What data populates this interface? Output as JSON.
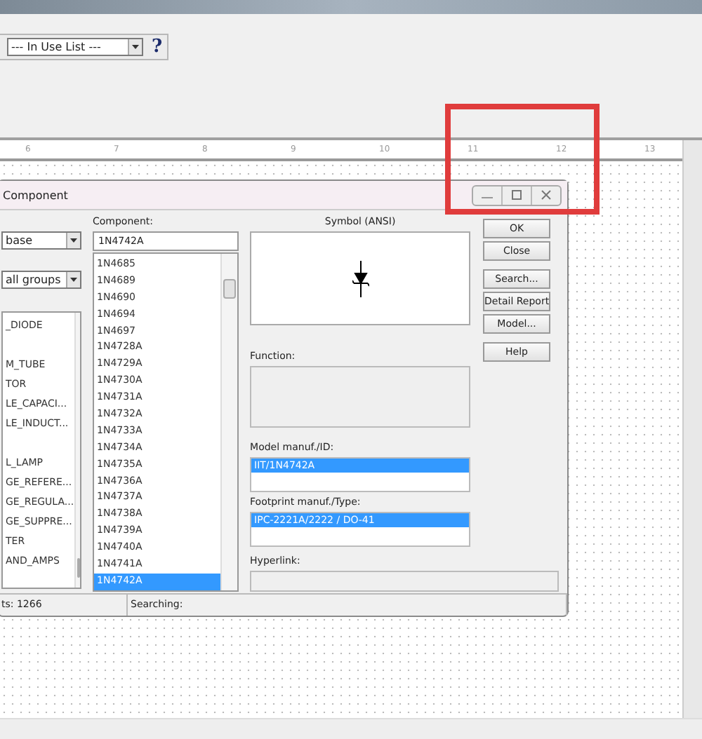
{
  "toolbar": {
    "list_dropdown": "--- In Use List ---",
    "help": "?"
  },
  "ruler": [
    "6",
    "7",
    "8",
    "9",
    "10",
    "11",
    "12",
    "13"
  ],
  "dialog": {
    "title": "Component",
    "database_dropdown": "base",
    "group_dropdown": "all groups",
    "family_groups": [
      [
        "_DIODE"
      ],
      [
        "M_TUBE",
        "TOR",
        "LE_CAPACI...",
        "LE_INDUCT..."
      ],
      [
        "L_LAMP",
        "GE_REFERE...",
        "GE_REGULA...",
        "GE_SUPPRE...",
        "TER",
        "AND_AMPS"
      ]
    ],
    "component_label": "Component:",
    "component_value": "1N4742A",
    "components": [
      {
        "text": "1N4685",
        "selected": false
      },
      {
        "text": "1N4689",
        "selected": false
      },
      {
        "text": "1N4690",
        "selected": false
      },
      {
        "text": "1N4694",
        "selected": false
      },
      {
        "text": "1N4697",
        "selected": false
      },
      {
        "text": "1N4728A",
        "selected": false
      },
      {
        "text": "1N4729A",
        "selected": false
      },
      {
        "text": "1N4730A",
        "selected": false
      },
      {
        "text": "1N4731A",
        "selected": false
      },
      {
        "text": "1N4732A",
        "selected": false
      },
      {
        "text": "1N4733A",
        "selected": false
      },
      {
        "text": "1N4734A",
        "selected": false
      },
      {
        "text": "1N4735A",
        "selected": false
      },
      {
        "text": "1N4736A",
        "selected": false
      },
      {
        "text": "1N4737A",
        "selected": false
      },
      {
        "text": "1N4738A",
        "selected": false
      },
      {
        "text": "1N4739A",
        "selected": false
      },
      {
        "text": "1N4740A",
        "selected": false
      },
      {
        "text": "1N4741A",
        "selected": false
      },
      {
        "text": "1N4742A",
        "selected": true
      }
    ],
    "symbol_label": "Symbol (ANSI)",
    "function_label": "Function:",
    "model_label": "Model manuf./ID:",
    "model_value": "IIT/1N4742A",
    "footprint_label": "Footprint manuf./Type:",
    "footprint_value": "IPC-2221A/2222 / DO-41",
    "hyperlink_label": "Hyperlink:",
    "button_groups": [
      [
        "OK",
        "Close"
      ],
      [
        "Search...",
        "Detail Report",
        "Model..."
      ],
      [
        "Help"
      ]
    ],
    "status": [
      "ts: 1266",
      "Searching:"
    ]
  }
}
